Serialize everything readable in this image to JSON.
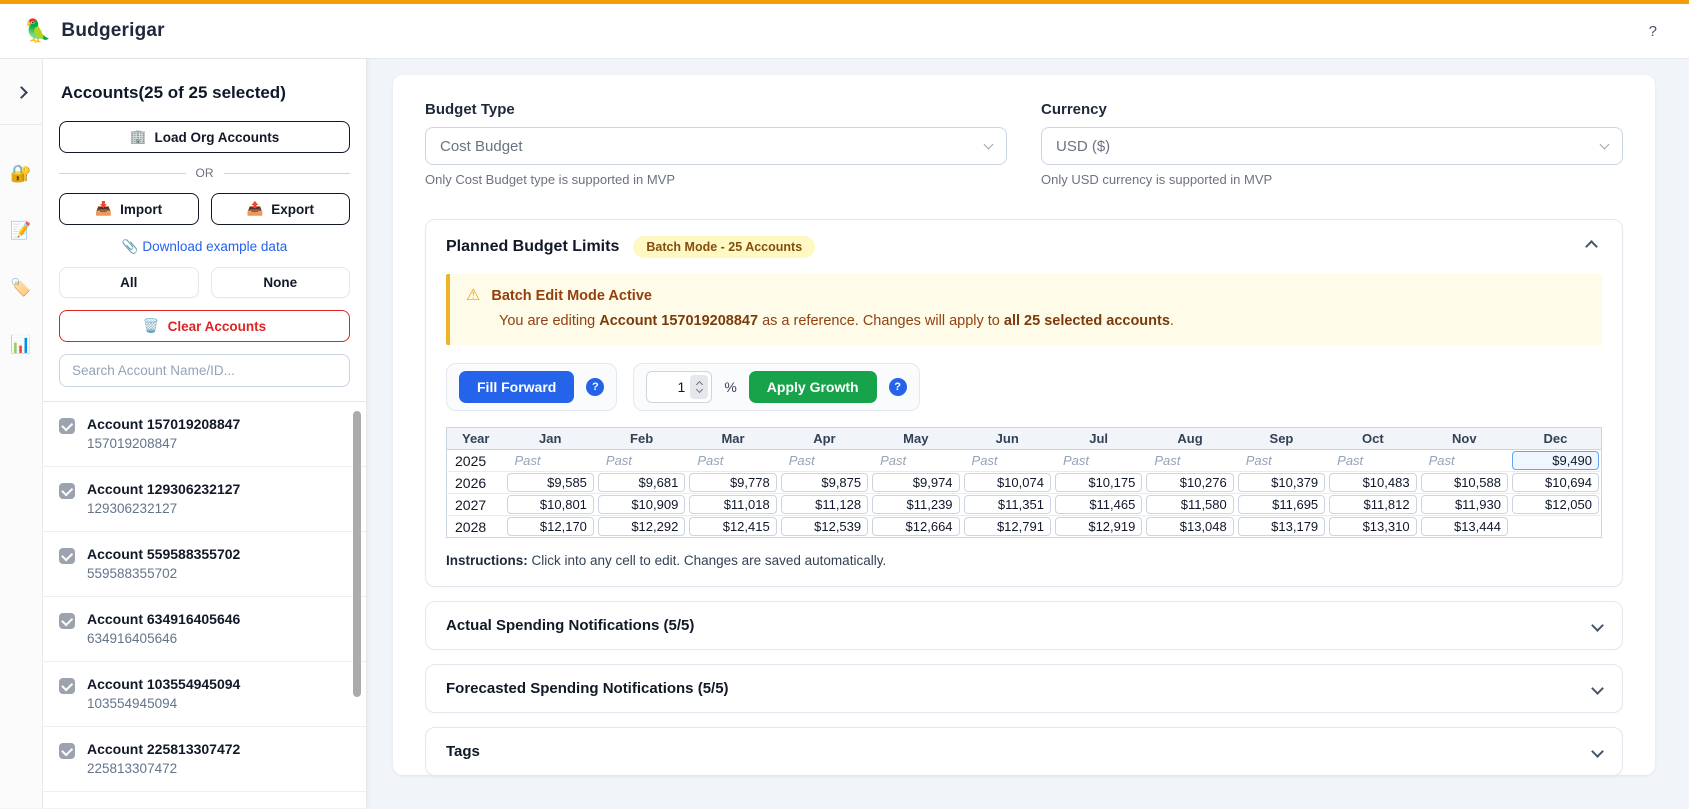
{
  "header": {
    "logo_icon": "🦜",
    "title": "Budgerigar",
    "help_label": "?"
  },
  "rail": {
    "icons": [
      {
        "name": "lock-icon",
        "glyph": "🔐"
      },
      {
        "name": "memo-icon",
        "glyph": "📝"
      },
      {
        "name": "tag-icon",
        "glyph": "🏷️"
      },
      {
        "name": "chart-icon",
        "glyph": "📊"
      }
    ]
  },
  "accounts_panel": {
    "title": "Accounts(25 of 25 selected)",
    "load_org": {
      "icon": "🏢",
      "label": "Load Org Accounts"
    },
    "or_label": "OR",
    "import_btn": {
      "icon": "📥",
      "label": "Import"
    },
    "export_btn": {
      "icon": "📤",
      "label": "Export"
    },
    "download": {
      "icon": "📎",
      "label": "Download example data"
    },
    "all_label": "All",
    "none_label": "None",
    "clear": {
      "icon": "🗑️",
      "label": "Clear Accounts"
    },
    "search_placeholder": "Search Account Name/ID...",
    "accounts": [
      {
        "name": "Account 157019208847",
        "id": "157019208847",
        "checked": true
      },
      {
        "name": "Account 129306232127",
        "id": "129306232127",
        "checked": true
      },
      {
        "name": "Account 559588355702",
        "id": "559588355702",
        "checked": true
      },
      {
        "name": "Account 634916405646",
        "id": "634916405646",
        "checked": true
      },
      {
        "name": "Account 103554945094",
        "id": "103554945094",
        "checked": true
      },
      {
        "name": "Account 225813307472",
        "id": "225813307472",
        "checked": true
      }
    ]
  },
  "main": {
    "budget_type": {
      "label": "Budget Type",
      "value": "Cost Budget",
      "helper": "Only Cost Budget type is supported in MVP"
    },
    "currency": {
      "label": "Currency",
      "value": "USD ($)",
      "helper": "Only USD currency is supported in MVP"
    },
    "planned": {
      "title": "Planned Budget Limits",
      "badge": "Batch Mode - 25 Accounts",
      "warning": {
        "icon": "⚠",
        "title": "Batch Edit Mode Active",
        "pre": "You are editing ",
        "account": "Account 157019208847",
        "mid": " as a reference. Changes will apply to ",
        "strong": "all 25 selected accounts",
        "post": "."
      },
      "fill_forward_label": "Fill Forward",
      "growth_value": "1",
      "percent_label": "%",
      "apply_growth_label": "Apply Growth",
      "help_glyph": "?",
      "table": {
        "columns": [
          "Year",
          "Jan",
          "Feb",
          "Mar",
          "Apr",
          "May",
          "Jun",
          "Jul",
          "Aug",
          "Sep",
          "Oct",
          "Nov",
          "Dec"
        ],
        "rows": [
          {
            "year": "2025",
            "cells": [
              "Past",
              "Past",
              "Past",
              "Past",
              "Past",
              "Past",
              "Past",
              "Past",
              "Past",
              "Past",
              "Past",
              "$9,490"
            ]
          },
          {
            "year": "2026",
            "cells": [
              "$9,585",
              "$9,681",
              "$9,778",
              "$9,875",
              "$9,974",
              "$10,074",
              "$10,175",
              "$10,276",
              "$10,379",
              "$10,483",
              "$10,588",
              "$10,694"
            ]
          },
          {
            "year": "2027",
            "cells": [
              "$10,801",
              "$10,909",
              "$11,018",
              "$11,128",
              "$11,239",
              "$11,351",
              "$11,465",
              "$11,580",
              "$11,695",
              "$11,812",
              "$11,930",
              "$12,050"
            ]
          },
          {
            "year": "2028",
            "cells": [
              "$12,170",
              "$12,292",
              "$12,415",
              "$12,539",
              "$12,664",
              "$12,791",
              "$12,919",
              "$13,048",
              "$13,179",
              "$13,310",
              "$13,444",
              ""
            ]
          }
        ],
        "selected_cell": {
          "row": 0,
          "col": 11
        }
      },
      "instructions_label": "Instructions:",
      "instructions_text": " Click into any cell to edit. Changes are saved automatically."
    },
    "sections": [
      {
        "title": "Actual Spending Notifications (5/5)"
      },
      {
        "title": "Forecasted Spending Notifications (5/5)"
      },
      {
        "title": "Tags"
      }
    ]
  },
  "colors": {
    "topbar_amber": "#F59E0B",
    "accent_blue": "#2563EB",
    "accent_green": "#16A34A",
    "danger_red": "#DC2626",
    "badge_bg": "#FEF9C3",
    "badge_text": "#854D0E",
    "warning_bg": "#FEFCE8",
    "warning_border": "#F0B429",
    "warning_text": "#92400E",
    "selected_cell_bg": "#EFF6FF",
    "selected_cell_border": "#60A5FA"
  }
}
